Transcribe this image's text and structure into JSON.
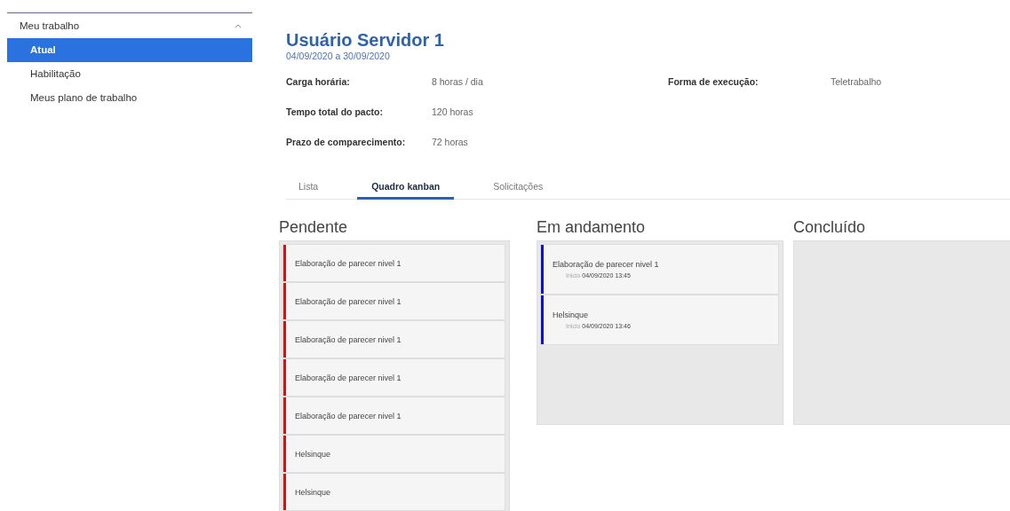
{
  "sidebar": {
    "group": {
      "label": "Meu trabalho",
      "expanded": true
    },
    "items": [
      {
        "label": "Atual",
        "selected": true
      },
      {
        "label": "Habilitação",
        "selected": false
      },
      {
        "label": "Meus plano de trabalho",
        "selected": false
      }
    ]
  },
  "header": {
    "title": "Usuário Servidor 1",
    "period": "04/09/2020 a 30/09/2020"
  },
  "details": [
    [
      {
        "label": "Carga horária:",
        "value": "8 horas / dia"
      },
      {
        "label": "Forma de execução:",
        "value": "Teletrabalho"
      }
    ],
    [
      {
        "label": "Tempo total do pacto:",
        "value": "120 horas"
      }
    ],
    [
      {
        "label": "Prazo de comparecimento:",
        "value": "72 horas"
      }
    ]
  ],
  "tabs": [
    {
      "label": "Lista",
      "selected": false
    },
    {
      "label": "Quadro kanban",
      "selected": true
    },
    {
      "label": "Solicitações",
      "selected": false
    }
  ],
  "columns": [
    {
      "title": "Pendente",
      "cards": [
        {
          "title": "Elaboração de parecer nivel 1",
          "color": "#d0121b"
        },
        {
          "title": "Elaboração de parecer nivel 1",
          "color": "#d0121b"
        },
        {
          "title": "Elaboração de parecer nivel 1",
          "color": "#d0121b"
        },
        {
          "title": "Elaboração de parecer nivel 1",
          "color": "#d0121b"
        },
        {
          "title": "Elaboração de parecer nivel 1",
          "color": "#d0121b"
        },
        {
          "title": "Helsinque",
          "color": "#d0121b"
        },
        {
          "title": "Helsinque",
          "color": "#d0121b"
        }
      ]
    },
    {
      "title": "Em andamento",
      "cards": [
        {
          "title": "Elaboração de parecer nivel 1",
          "color": "#1010c0",
          "start_label": "Inicio",
          "start": "04/09/2020 13:45"
        },
        {
          "title": "Helsinque",
          "color": "#1010c0",
          "start_label": "Inicio",
          "start": "04/09/2020 13:46"
        }
      ]
    },
    {
      "title": "Concluído"
    }
  ]
}
